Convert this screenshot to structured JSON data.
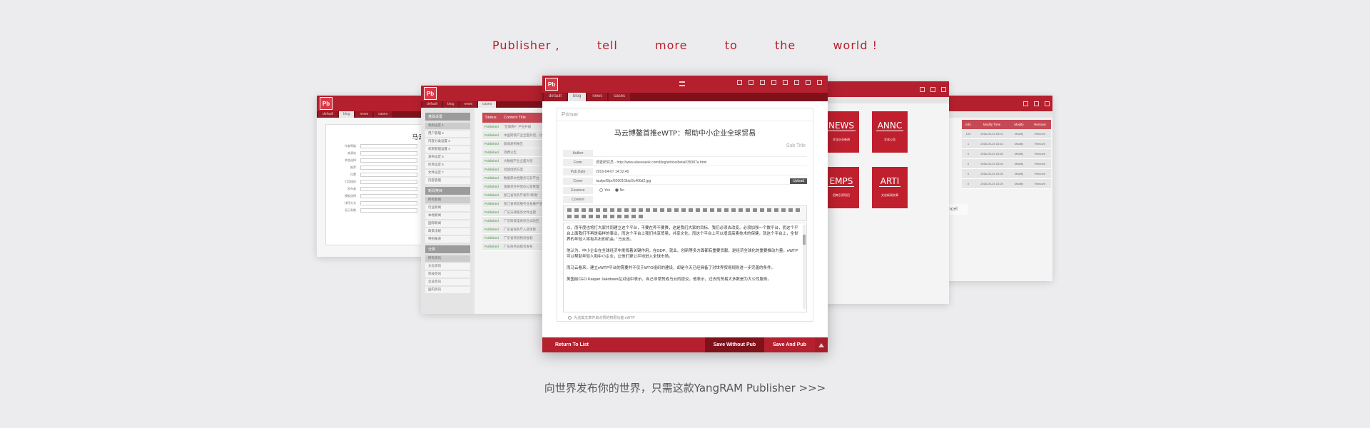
{
  "tagline": [
    "Publisher ,",
    "tell",
    "more",
    "to",
    "the",
    "world !"
  ],
  "footer_link": "向世界发布你的世界，只需这款YangRAM Publisher >>>",
  "logo": "Pb",
  "tabs": [
    "default",
    "blog",
    "news",
    "cases"
  ],
  "main": {
    "primer": "Primer",
    "article_title": "马云博鳌首推eWTP：帮助中小企业全球贸易",
    "subtitle": "Sub Title",
    "fields": [
      {
        "label": "Author",
        "value": ""
      },
      {
        "label": "From",
        "value": "调查研究员 · http://www.alseeaaok.com/blog/article/detail/35087a.html"
      },
      {
        "label": "Pub Date",
        "value": "2016-04-07 14:32:40"
      },
      {
        "label": "Cover",
        "value": "/aufpv/8/pr/60001f3bb/3c406d2.jpg"
      },
      {
        "label": "Essence",
        "value": ""
      },
      {
        "label": "Content",
        "value": ""
      }
    ],
    "upload_label": "Upload",
    "essence_options": [
      "Yes",
      "No"
    ],
    "paragraphs": [
      "以，而年度也将打大家共同建立这个平台，不要在养不要赛，这是我们大家的目标，我们必须去改变。必须加强一个数平台，而这个平台上面我们不再是每样的事业，而这个平台上我们共享贸易，共享文化，而这个平台上可以增设高素技术的保健，就这个平台上，全世界的年轻人将有共出的机会。” 马云说。",
      "他认为，中小企业在全球经济中发挥着关键作用，在GDP、就业、创新等多方面都有重要贡献，是经济全球化的重要推动力量。eWTP可以帮助年轻人和中小企业，让他们更公平地进入全球市场。",
      "而马云看来，建立eWTP平台的需要并不仅于WTO组织的建设，却是今天已经具备了对世界贸易规则进一步完善的条件。",
      "美国前CEO Kasper Jakobsen在对话中表示，自己非常赞成马云的提议，他表示，过去的贸易大多数是为大公司服务。"
    ],
    "checkbox_label": "为这篇文章开启点赞的权限功能 eWTP",
    "return_label": "Return To List",
    "save_nopub_label": "Save Without Pub",
    "save_pub_label": "Save And Pub"
  },
  "list": {
    "status_header": "Status",
    "title_header": "Content Title",
    "status_value": "Published",
    "rows": [
      "“互联网+” 产业升级",
      "中国跨境产业全面对话，讨论",
      "新闻发布报告",
      "消费公告",
      "大数据产业全面对话",
      "社团创新方案",
      "数据库文档服务与云平台",
      "金融对外开放办公室管理",
      "浙江省商务厅发布“跨境”",
      "浙江省商贸服务业发展产业",
      "广东法律服务文件主题",
      "广东跨境电商综合试验区",
      "广东省商务厅入选项目",
      "广东省商贸物流规划",
      "广东商务局联合发布"
    ],
    "groups": [
      {
        "head": "基础设置",
        "items": [
          "机构设定 1",
          "用户管理 2",
          "内容分类设置 3",
          "权限管理设置 4",
          "发布设定 5",
          "栏目设定 6",
          "文件设定 7",
          "内容管理"
        ]
      },
      {
        "head": "新闻类目",
        "items": [
          "所有新闻",
          "行业新闻",
          "本地新闻",
          "国际新闻",
          "政策法规",
          "特别报道"
        ]
      },
      {
        "head": "分类",
        "items": [
          "所有资讯",
          "文化资讯",
          "科技资讯",
          "企业资讯",
          "国内资讯"
        ]
      }
    ]
  },
  "form2": {
    "title": "马云博鳌首推",
    "labels": [
      "作者等级",
      "来源站",
      "状态选择",
      "推荐",
      "位置",
      "引用描述",
      "发布者",
      "模板选择",
      "排序方式",
      "显示条数"
    ]
  },
  "icons": {
    "tiles": [
      {
        "name": "NEWS",
        "desc": "文化企业新闻"
      },
      {
        "name": "ANNC",
        "desc": "文化公告"
      },
      {
        "name": "EMPS",
        "desc": "招商引资项目"
      },
      {
        "name": "ARTI",
        "desc": "文化新闻文章"
      }
    ]
  },
  "table": {
    "headers": [
      "Info",
      "Modify Time",
      "Modify",
      "Remove"
    ],
    "rows": [
      [
        "100",
        "2016-05-24 15:01",
        "Modify",
        "Remove"
      ],
      [
        "1",
        "2016-05-24 16:43",
        "Modify",
        "Remove"
      ],
      [
        "0",
        "2016-05-24 15:26",
        "Modify",
        "Remove"
      ],
      [
        "0",
        "2016-05-24 15:04",
        "Modify",
        "Remove"
      ],
      [
        "0",
        "2016-05-24 15:25",
        "Modify",
        "Remove"
      ],
      [
        "0",
        "2016-05-24 15:25",
        "Modify",
        "Remove"
      ]
    ],
    "cancel_label": "Cancel"
  },
  "colors": {
    "brand": "#b5202e",
    "brand_dark": "#7f111b",
    "status_green": "#3a9a3a"
  }
}
